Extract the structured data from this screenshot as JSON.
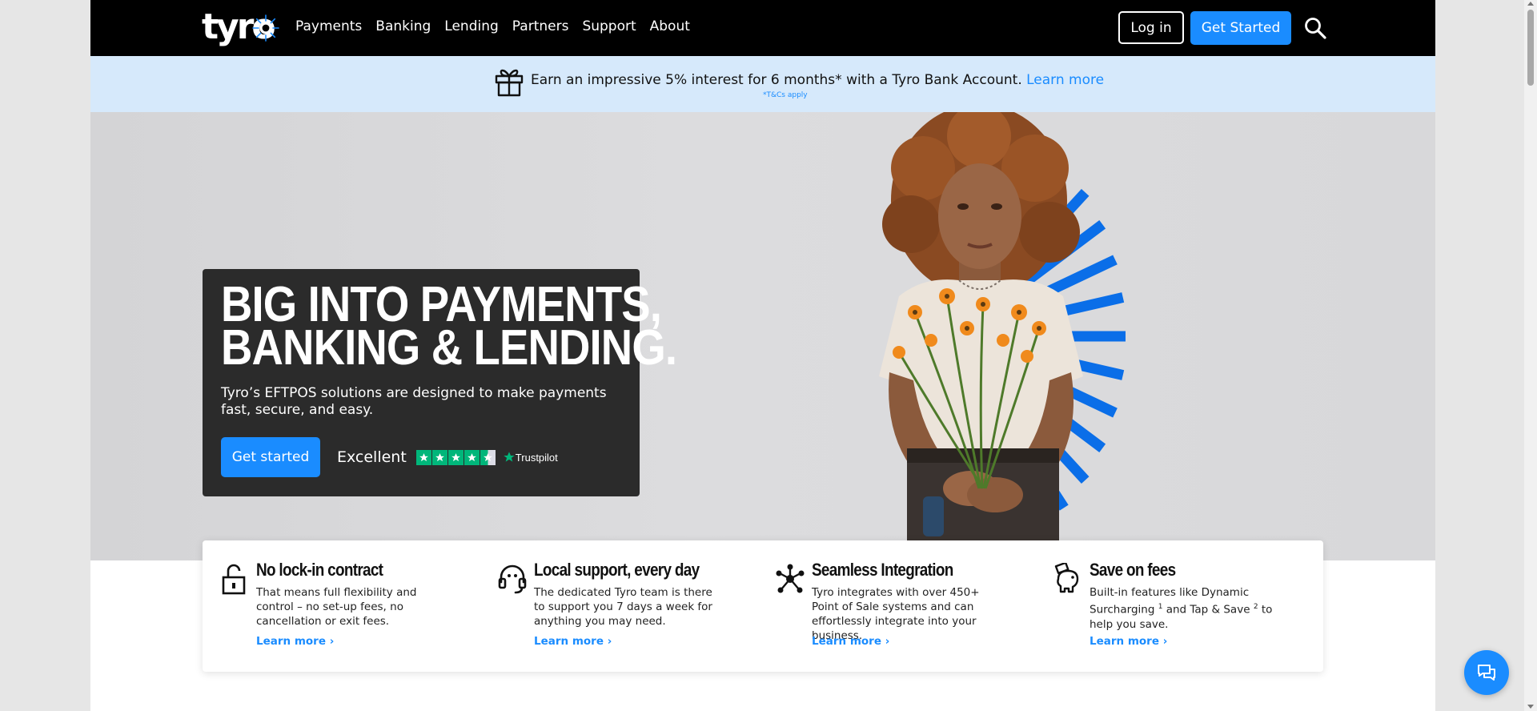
{
  "nav": {
    "logo_text": "tyro",
    "links": [
      "Payments",
      "Banking",
      "Lending",
      "Partners",
      "Support",
      "About"
    ],
    "login_label": "Log in",
    "get_started_label": "Get Started",
    "search_icon": "search-icon"
  },
  "banner": {
    "text": "Earn an impressive 5% interest for 6 months* with a Tyro Bank Account.",
    "link_label": "Learn more",
    "tc_note": "*T&Cs apply",
    "icon": "gift-icon"
  },
  "hero": {
    "title_line1": "BIG INTO PAYMENTS,",
    "title_line2": "BANKING & LENDING.",
    "subtitle": "Tyro’s EFTPOS solutions are designed to make payments fast, secure, and easy.",
    "cta_label": "Get started",
    "trustpilot": {
      "rating_text": "Excellent",
      "stars": 4.5,
      "brand": "Trustpilot"
    }
  },
  "features": [
    {
      "title": "No lock-in contract",
      "description": "That means full flexibility and control – no set-up fees, no cancellation or exit fees.",
      "link": "Learn more",
      "icon": "unlock-icon"
    },
    {
      "title": "Local support, every day",
      "description": "The dedicated Tyro team is there to support you 7 days a week for anything you may need.",
      "link": "Learn more",
      "icon": "headset-icon"
    },
    {
      "title": "Seamless Integration",
      "description": "Tyro integrates with over 450+ Point of Sale systems and can effortlessly integrate into your business.",
      "link": "Learn more",
      "icon": "network-icon"
    },
    {
      "title": "Save on fees",
      "description_part1": "Built-in features like Dynamic Surcharging",
      "sup1": "1",
      "description_part2": " and Tap & Save",
      "sup2": "2",
      "description_part3": " to help you save.",
      "link": "Learn more",
      "icon": "piggy-bank-icon"
    }
  ],
  "chat": {
    "icon": "chat-icon"
  },
  "colors": {
    "brand_blue": "#1a8cff",
    "nav_bg": "#000000",
    "banner_bg": "#d6e9fb",
    "card_bg": "#2b2b2b",
    "trustpilot_green": "#00b67a"
  }
}
